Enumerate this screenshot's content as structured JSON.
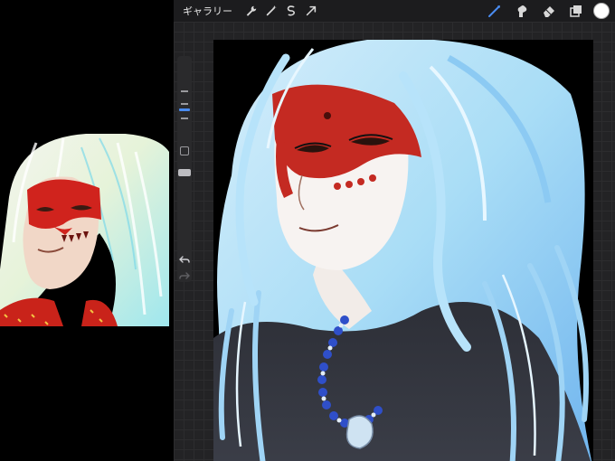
{
  "topbar": {
    "gallery_label": "ギャラリー",
    "left_icons": [
      "wrench-icon",
      "magic-wand-icon",
      "selection-icon",
      "transform-arrow-icon"
    ],
    "right_icons": [
      "brush-icon",
      "smudge-icon",
      "eraser-icon",
      "layers-icon"
    ],
    "active_tool": "brush",
    "current_color": "#ffffff"
  },
  "sidebar": {
    "brush_size_level": 0.35,
    "brush_opacity_level": 0.62,
    "undo_icon": "undo-icon",
    "redo_icon": "redo-icon"
  },
  "colors": {
    "accent": "#4a8cf0",
    "face_paint": "#c42a22",
    "hair": "#a9ddf6"
  }
}
